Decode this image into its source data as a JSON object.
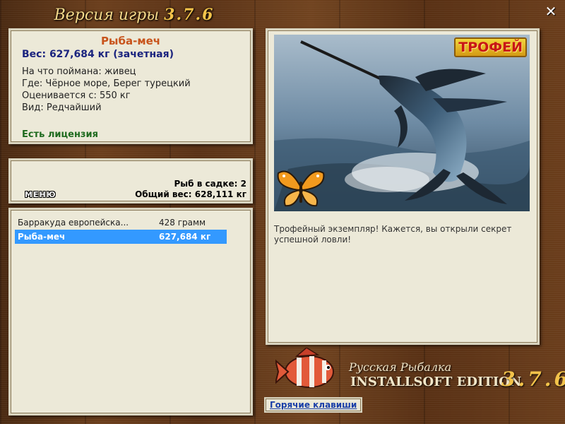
{
  "window": {
    "title_prefix": "Версия игры",
    "title_version": "3.7.6",
    "close_glyph": "✕"
  },
  "fish_info": {
    "name": "Рыба-меч",
    "weight": "Вес: 627,684 кг (зачетная)",
    "bait": "На что поймана: живец",
    "location": "Где: Чёрное море, Берег турецкий",
    "valued_from": "Оценивается с: 550 кг",
    "rarity": "Вид: Редчайший",
    "license": "Есть лицензия"
  },
  "stats": {
    "menu_label": "МЕНЮ",
    "count": "Рыб в садке: 2",
    "total": "Общий вес: 628,111 кг"
  },
  "catch_list": [
    {
      "name": "Барракуда европейска...",
      "weight": "428 грамм",
      "selected": false
    },
    {
      "name": "Рыба-меч",
      "weight": "627,684 кг",
      "selected": true
    }
  ],
  "picture": {
    "trophy_label": "ТРОФЕЙ",
    "description": "Трофейный экземпляр! Кажется, вы открыли секрет успешной ловли!"
  },
  "brand": {
    "line1": "Русская Рыбалка",
    "line2": "INSTALLSOFT EDITION",
    "version": "3.7.6"
  },
  "hotkeys_label": "Горячие клавиши",
  "colors": {
    "accent_orange": "#c8541c",
    "weight_navy": "#1a237e",
    "license_green": "#1f6b1f",
    "selection_blue": "#3399ff",
    "version_gold": "#f3c34a"
  }
}
